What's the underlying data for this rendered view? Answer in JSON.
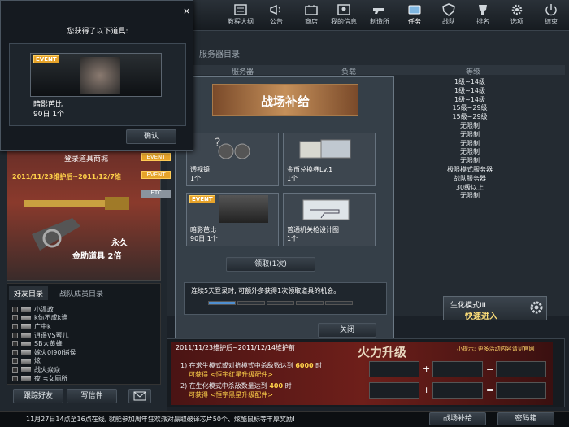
{
  "nav": [
    {
      "label": "教程大纲",
      "icon": "tutorial-icon"
    },
    {
      "label": "公告",
      "icon": "megaphone-icon"
    },
    {
      "label": "商店",
      "icon": "shop-icon"
    },
    {
      "label": "我的信息",
      "icon": "profile-icon"
    },
    {
      "label": "制造所",
      "icon": "gun-icon"
    },
    {
      "label": "任务",
      "icon": "mission-icon"
    },
    {
      "label": "战队",
      "icon": "shield-icon"
    },
    {
      "label": "排名",
      "icon": "trophy-icon"
    },
    {
      "label": "选项",
      "icon": "gear-icon"
    },
    {
      "label": "结束",
      "icon": "power-icon"
    }
  ],
  "popup": {
    "title": "您获得了以下道具:",
    "event_badge": "EVENT",
    "item_name": "暗影芭比",
    "item_count": "90日 1个",
    "confirm": "确认",
    "close": "×"
  },
  "server_list": {
    "title": "服务器目录",
    "col1": "服务器",
    "col2": "负载",
    "col3": "等级"
  },
  "tiers": [
    "1级~14级",
    "1级~14级",
    "1级~14级",
    "15级~29级",
    "15级~29级",
    "无限制",
    "无限制",
    "无限制",
    "无限制",
    "无限制",
    "极限模式服务器",
    "战队服务器",
    "30级以上",
    "无限制"
  ],
  "dialog": {
    "banner": "战场补给",
    "items": [
      {
        "name": "透视镜",
        "count": "1个",
        "event": false
      },
      {
        "name": "金币兑换券Lv.1",
        "count": "1个",
        "event": false
      },
      {
        "name": "暗影芭比",
        "count": "90日  1个",
        "event": true
      },
      {
        "name": "普通机关枪设计图",
        "count": "1个",
        "event": false
      }
    ],
    "claim": "领取(1次)",
    "note": "连续5天登录时, 可额外多获得1次领取道具的机会。",
    "close": "关闭",
    "event_badge": "EVENT"
  },
  "side_badges": [
    "EVENT",
    "EVENT",
    "ETC"
  ],
  "promo": {
    "header": "登录道具商城",
    "dates": "2011/11/23维护后~2011/12/7维",
    "line1": "永久",
    "line2": "金助道具 2倍"
  },
  "friends": {
    "tab1": "好友目录",
    "tab2": "战队成员目录",
    "list": [
      "小温政",
      "k你不成k谁",
      "广中k",
      "逍遥VS蜜儿",
      "SB大黄蜂",
      "嫁火0l90l诸侯",
      "炫",
      "战火焱焱",
      "夜  ≒女厕所"
    ],
    "follow": "跟踪好友",
    "mail": "写信件",
    "envelope": "envelope-icon"
  },
  "right_panel": {
    "mode": "生化模式III",
    "quick": "快速进入",
    "gear": "gear-icon"
  },
  "update": {
    "dates": "2011/11/23维护后~2011/12/14维护前",
    "title": "火力升级",
    "hint": "小提示: 更多活动内容请见官网",
    "line1_a": "1) 在求生模式或对抗模式中杀敌数达到",
    "line1_b": "6000",
    "line1_c": "时",
    "line1_reward": "可获得 <恒宇红星升级配件>",
    "line2_a": "2) 在生化模式中杀敌数量达到",
    "line2_b": "400",
    "line2_c": "时",
    "line2_reward": "可获得  <恒宇黑星升级配件>"
  },
  "footer": {
    "ticker": "11月27日14点至16点在线, 就能参加周年狂欢派对赢取破译芯片50个、炫酷鼠标等丰厚奖励!",
    "supply": "战场补给",
    "password": "密码箱"
  },
  "colors": {
    "accent": "#e6a32a",
    "red": "#c83a2a"
  }
}
